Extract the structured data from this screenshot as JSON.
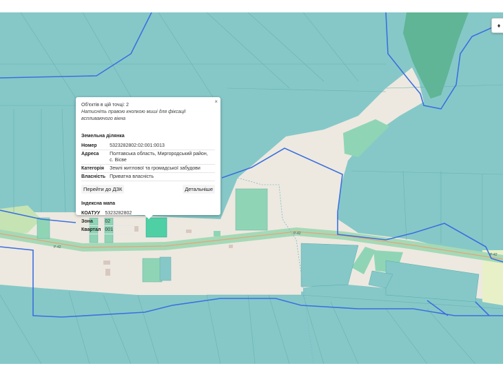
{
  "map": {
    "road_labels": [
      "Р-42",
      "Р-42",
      "Р-42"
    ]
  },
  "popup": {
    "close_label": "×",
    "objects_count": "Об'єктів в цій точці: 2",
    "hint": "Натисніть правою кнопкою миші для фіксації вспливаючого вікна",
    "parcel": {
      "title": "Земельна ділянка",
      "rows": [
        {
          "key": "Номер",
          "value": "5323282802:02:001:0013"
        },
        {
          "key": "Адреса",
          "value": "Полтавська область, Миргородський район, с. Вісве"
        },
        {
          "key": "Категорія",
          "value": "Землі житлової та громадської забудови"
        },
        {
          "key": "Власність",
          "value": "Приватна власність"
        }
      ],
      "goto_button": "Перейти до ДЗК",
      "details_button": "Детальніше"
    },
    "index_map": {
      "title": "Індексна мапа",
      "rows": [
        {
          "key": "КОАТУУ",
          "value": "5323282802"
        },
        {
          "key": "Зона",
          "value": "02"
        },
        {
          "key": "Квартал",
          "value": "001"
        }
      ]
    }
  },
  "controls": {
    "layers_icon": "layers-icon"
  },
  "colors": {
    "parcel_teal": "#86c8c8",
    "parcel_green": "#7fd6b2",
    "road_band": "#a5d9b6",
    "settlement": "#ede9e0",
    "boundary_blue": "#3b6fe0",
    "selected_parcel": "#4fcfa4"
  }
}
